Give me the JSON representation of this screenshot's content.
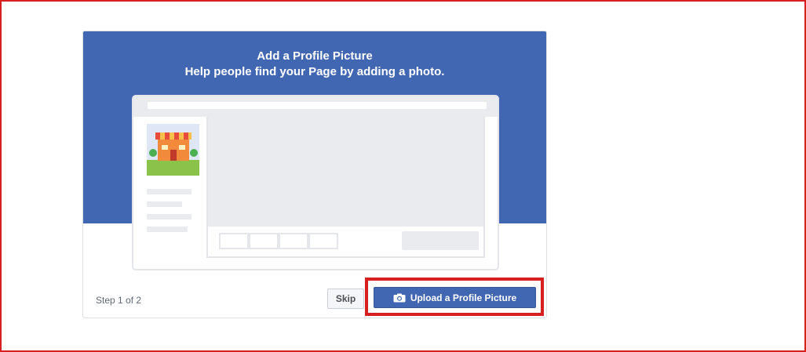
{
  "dialog": {
    "title": "Add a Profile Picture",
    "subtitle": "Help people find your Page by adding a photo.",
    "step_label": "Step 1 of 2",
    "skip_label": "Skip",
    "upload_label": "Upload a Profile Picture",
    "upload_icon": "camera-icon"
  },
  "colors": {
    "banner": "#4267b2",
    "highlight": "#d71f1f",
    "frame": "#d92020"
  }
}
